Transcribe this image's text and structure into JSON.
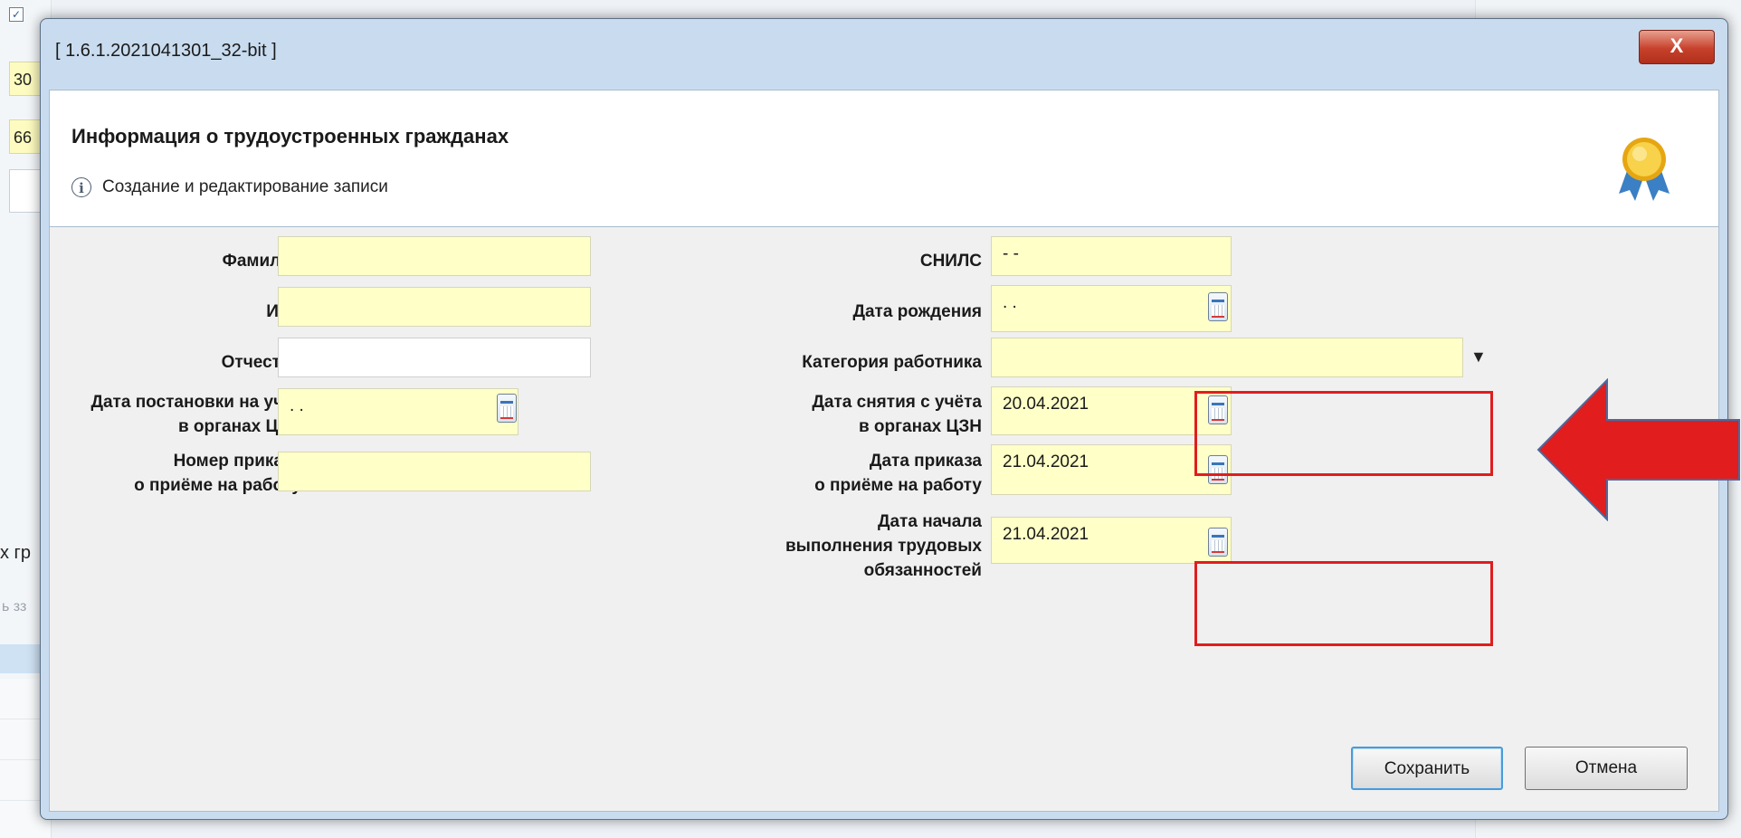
{
  "background": {
    "cells": [
      "30",
      "66"
    ],
    "fragment_1": "х гр",
    "fragment_2": "ь зз"
  },
  "dialog": {
    "window_title": "[ 1.6.1.2021041301_32-bit ]",
    "close_label": "X",
    "header": {
      "title": "Информация о трудоустроенных гражданах",
      "subtitle": "Создание и редактирование записи",
      "info_icon": "info-icon",
      "badge_icon": "award-badge-icon"
    },
    "form": {
      "surname": {
        "label": "Фамилия",
        "value": ""
      },
      "name": {
        "label": "Имя",
        "value": ""
      },
      "patronymic": {
        "label": "Отчество",
        "value": ""
      },
      "registration_date": {
        "label_line1": "Дата постановки на учёт",
        "label_line2": "в органах ЦЗН",
        "value": " . ."
      },
      "order_number": {
        "label_line1": "Номер приказа",
        "label_line2": "о приёме на работу",
        "value": ""
      },
      "snils": {
        "label": "СНИЛС",
        "value": "-  -"
      },
      "birth_date": {
        "label": "Дата рождения",
        "value": " . ."
      },
      "worker_category": {
        "label": "Категория работника",
        "value": ""
      },
      "deregistration_date": {
        "label_line1": "Дата снятия с учёта",
        "label_line2": "в органах ЦЗН",
        "value": "20.04.2021"
      },
      "order_date": {
        "label_line1": "Дата приказа",
        "label_line2": "о приёме на работу",
        "value": "21.04.2021"
      },
      "start_date": {
        "label_line1": "Дата начала",
        "label_line2": "выполнения трудовых",
        "label_line3": "обязанностей",
        "value": "21.04.2021"
      }
    },
    "buttons": {
      "save": "Сохранить",
      "cancel": "Отмена"
    }
  },
  "colors": {
    "required_field": "#ffffc8",
    "highlight": "#e11d1d",
    "primary_border": "#4a9bd8"
  }
}
